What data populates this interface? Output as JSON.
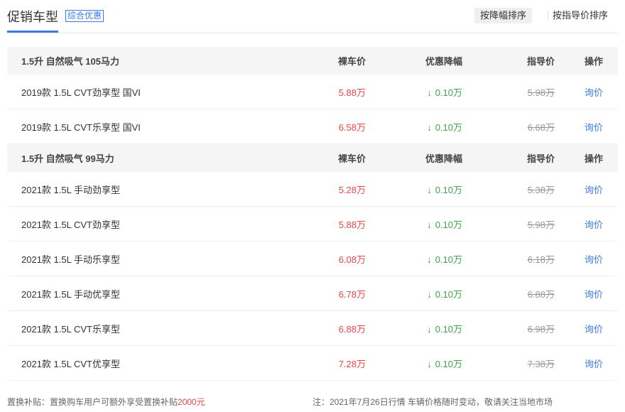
{
  "header": {
    "title": "促销车型",
    "badge": "综合优惠",
    "sort_discount": "按降幅排序",
    "sort_guide": "按指导价排序"
  },
  "columns": {
    "price": "裸车价",
    "discount": "优惠降幅",
    "guide": "指导价",
    "op": "操作"
  },
  "groups": [
    {
      "name": "1.5升 自然吸气 105马力",
      "rows": [
        {
          "name": "2019款 1.5L CVT劲享型 国VI",
          "price": "5.88万",
          "discount": "0.10万",
          "guide": "5.98万",
          "op": "询价"
        },
        {
          "name": "2019款 1.5L CVT乐享型 国VI",
          "price": "6.58万",
          "discount": "0.10万",
          "guide": "6.68万",
          "op": "询价"
        }
      ]
    },
    {
      "name": "1.5升 自然吸气 99马力",
      "rows": [
        {
          "name": "2021款 1.5L 手动劲享型",
          "price": "5.28万",
          "discount": "0.10万",
          "guide": "5.38万",
          "op": "询价"
        },
        {
          "name": "2021款 1.5L CVT劲享型",
          "price": "5.88万",
          "discount": "0.10万",
          "guide": "5.98万",
          "op": "询价"
        },
        {
          "name": "2021款 1.5L 手动乐享型",
          "price": "6.08万",
          "discount": "0.10万",
          "guide": "6.18万",
          "op": "询价"
        },
        {
          "name": "2021款 1.5L 手动优享型",
          "price": "6.78万",
          "discount": "0.10万",
          "guide": "6.88万",
          "op": "询价"
        },
        {
          "name": "2021款 1.5L CVT乐享型",
          "price": "6.88万",
          "discount": "0.10万",
          "guide": "6.98万",
          "op": "询价"
        },
        {
          "name": "2021款 1.5L CVT优享型",
          "price": "7.28万",
          "discount": "0.10万",
          "guide": "7.38万",
          "op": "询价"
        }
      ]
    }
  ],
  "footer": {
    "left_prefix": "置换补贴：置换购车用户可额外享受置换补贴",
    "left_amount": "2000元",
    "right": "注：2021年7月26日行情 车辆价格随时变动，敬请关注当地市场"
  },
  "colors": {
    "accent": "#3b7be0",
    "price": "#e64646",
    "discount": "#3da34b"
  },
  "icons": {
    "discount": "arrow-down-icon"
  }
}
